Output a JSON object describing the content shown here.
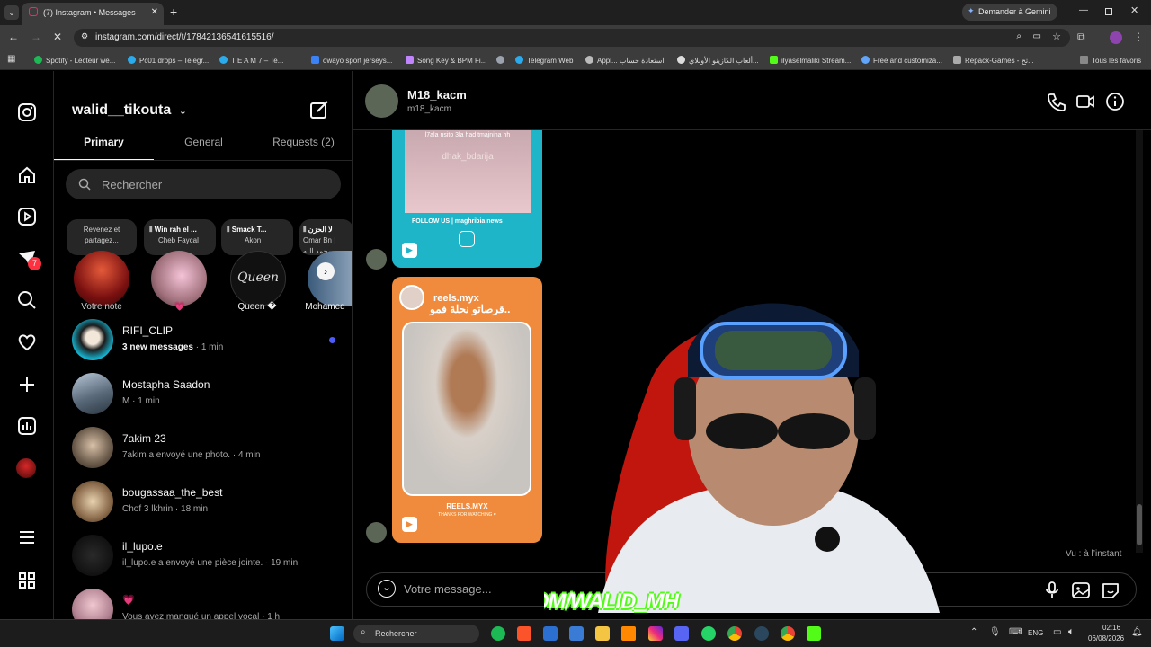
{
  "browser": {
    "tab_title": "(7) Instagram • Messages",
    "url": "instagram.com/direct/t/17842136541615516/",
    "gemini_label": "Demander à Gemini",
    "bookmarks": [
      "Spotify - Lecteur we...",
      "Pc01 drops – Telegr...",
      "T E A M 7 – Te...",
      "owayo sport jerseys...",
      "Song Key & BPM Fi...",
      "Telegram Web",
      "Appl... استعادة حساب",
      "ألعاب الكازينو الأونلاي...",
      "ilyaselmaliki Stream...",
      "Free and customiza...",
      "Repack-Games - تح..."
    ],
    "all_bookmarks": "Tous les favoris"
  },
  "nav": {
    "notifications_badge": "7"
  },
  "inbox": {
    "username": "walid__tikouta",
    "tabs": [
      "Primary",
      "General",
      "Requests (2)"
    ],
    "search_placeholder": "Rechercher",
    "notes": [
      {
        "text": "Revenez et partagez...",
        "label": "Votre note"
      },
      {
        "song": "Win rah el ...",
        "artist": "Cheb Faycal",
        "label": "💗"
      },
      {
        "song": "Smack T...",
        "artist": "Akon",
        "label": "Queen �"
      },
      {
        "song": "لا الحزن",
        "artist": "Omar Bn | محمد الله",
        "label": "Mohamed"
      }
    ],
    "queen_logo": "Queen",
    "conversations": [
      {
        "name": "RIFI_CLIP",
        "sub_bold": "3 new messages",
        "time": "· 1 min"
      },
      {
        "name": "Mostapha Saadon",
        "sub": "M · 1 min"
      },
      {
        "name": "7akim 23",
        "sub": "7akim a envoyé une photo. · 4 min"
      },
      {
        "name": "bougassaa_the_best",
        "sub": "Chof 3 lkhrin · 18 min"
      },
      {
        "name": "il_lupo.e",
        "sub": "il_lupo.e a envoyé une pièce jointe. · 19 min"
      },
      {
        "name": "💗",
        "sub": "Vous avez manqué un appel vocal · 1 h"
      }
    ]
  },
  "chat": {
    "contact_name": "M18_kacm",
    "contact_handle": "m18_kacm",
    "reel1": {
      "caption": "l7ala nsito 3la had tmajnina hh",
      "watermark": "dhak_bdarija",
      "footer": "FOLLOW US | maghribia news"
    },
    "reel2": {
      "account": "reels.myx",
      "title": "قرصاتو نحلة فمو..",
      "brand": "REELS.MYX",
      "thanks": "THANKS FOR WATCHING ♥"
    },
    "seen": "Vu : à l’instant",
    "message_placeholder": "Votre message...",
    "stream_overlay": "KICK.COM/WALID_MH"
  },
  "taskbar": {
    "search": "Rechercher",
    "lang": "ENG",
    "time": "02:16",
    "date": "06/08/2026"
  },
  "colors": {
    "reel1_bg": "#1fb5c9",
    "reel2_bg": "#f08a3c",
    "unread_dot": "#4d5bf9",
    "kick_green": "#53fc18",
    "badge_red": "#ff3040"
  }
}
